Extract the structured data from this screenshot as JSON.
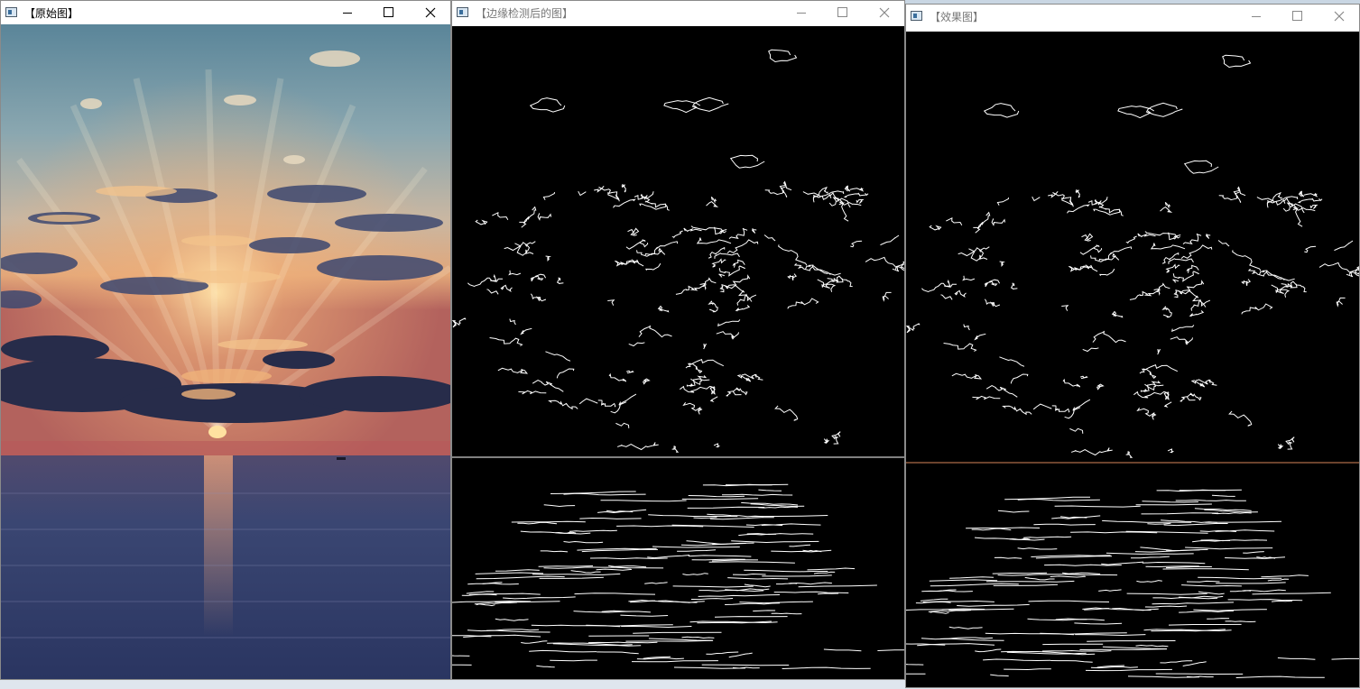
{
  "windows": [
    {
      "id": "original",
      "title": "【原始图】",
      "active": true,
      "controls": [
        "minimize-icon",
        "maximize-icon",
        "close-icon"
      ]
    },
    {
      "id": "edges",
      "title": "【边缘检测后的图】",
      "active": false,
      "controls": [
        "minimize-icon",
        "maximize-icon",
        "close-icon"
      ]
    },
    {
      "id": "effect",
      "title": "【效果图】",
      "active": false,
      "controls": [
        "minimize-icon",
        "maximize-icon",
        "close-icon"
      ]
    }
  ],
  "colors": {
    "sky_top": "#5a8599",
    "sky_mid": "#9fb0b4",
    "glow": "#e8a86a",
    "sun": "#ffd88a",
    "clouds_dark": "#2a2f4e",
    "sea": "#2d3a66",
    "edge_line": "#ffffff",
    "horizon_tint": "#d9865a"
  }
}
